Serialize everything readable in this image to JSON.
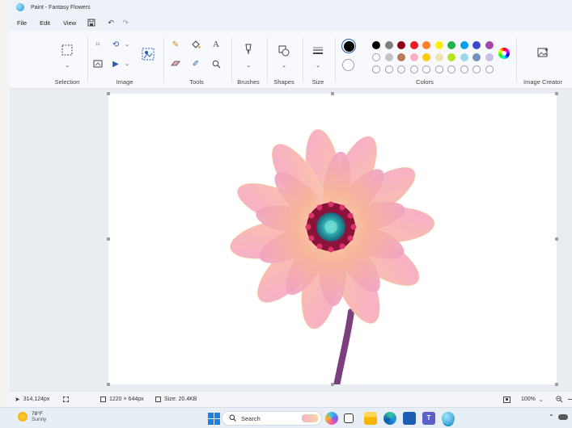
{
  "window": {
    "title": "Paint - Fantasy Flowers"
  },
  "menu": {
    "items": [
      "File",
      "Edit",
      "View"
    ]
  },
  "ribbon": {
    "groups": {
      "selection": "Selection",
      "image": "Image",
      "tools": "Tools",
      "brushes": "Brushes",
      "shapes": "Shapes",
      "size": "Size",
      "colors": "Colors",
      "image_creator": "Image Creator"
    },
    "palette_row1": [
      "#000000",
      "#7f7f7f",
      "#880015",
      "#ed1c24",
      "#ff7f27",
      "#fff200",
      "#22b14c",
      "#00a2e8",
      "#3f48cc",
      "#a349a4"
    ],
    "palette_row2": [
      "#ffffff",
      "#c3c3c3",
      "#b97a57",
      "#ffaec9",
      "#ffc90e",
      "#efe4b0",
      "#b5e61d",
      "#99d9ea",
      "#7092be",
      "#c8bfe7"
    ],
    "primary_color": "#000000",
    "secondary_color": "#ffffff"
  },
  "status": {
    "cursor_pos": "314,124px",
    "canvas_size": "1220 × 644px",
    "file_size": "Size: 20.4KB",
    "zoom": "100%"
  },
  "taskbar": {
    "weather_temp": "78°F",
    "weather_desc": "Sunny",
    "search_placeholder": "Search"
  }
}
